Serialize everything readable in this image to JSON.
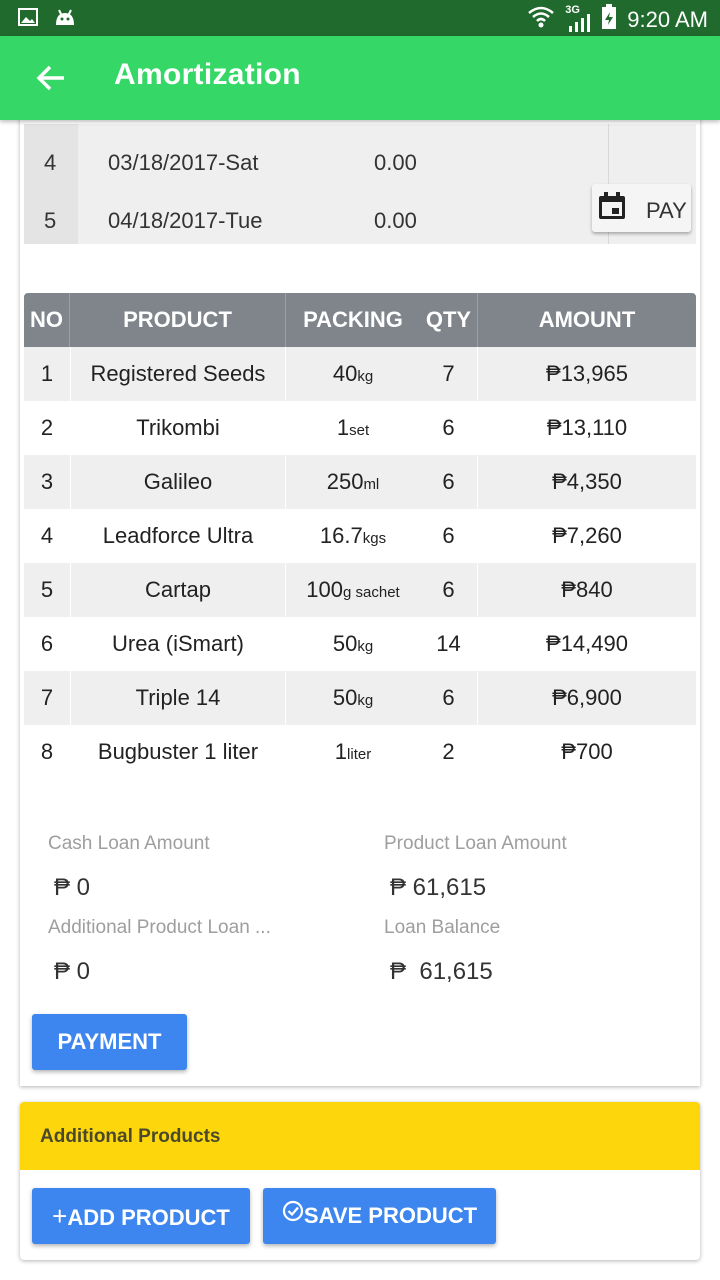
{
  "status_bar": {
    "time": "9:20 AM",
    "network": "3G"
  },
  "app_bar": {
    "title": "Amortization"
  },
  "schedule": {
    "rows": [
      {
        "no": "4",
        "date": "03/18/2017-Sat",
        "amount": "0.00"
      },
      {
        "no": "5",
        "date": "04/18/2017-Tue",
        "amount": "0.00"
      }
    ],
    "pay_label": "PAY"
  },
  "products": {
    "headers": {
      "no": "NO",
      "product": "PRODUCT",
      "packing": "PACKING",
      "qty": "QTY",
      "amount": "AMOUNT"
    },
    "rows": [
      {
        "no": "1",
        "product": "Registered Seeds",
        "pack_qty": "40",
        "pack_unit": "kg",
        "qty": "7",
        "amount": "₱13,965"
      },
      {
        "no": "2",
        "product": "Trikombi",
        "pack_qty": "1",
        "pack_unit": "set",
        "qty": "6",
        "amount": "₱13,110"
      },
      {
        "no": "3",
        "product": "Galileo",
        "pack_qty": "250",
        "pack_unit": "ml",
        "qty": "6",
        "amount": "₱4,350"
      },
      {
        "no": "4",
        "product": "Leadforce Ultra",
        "pack_qty": "16.7",
        "pack_unit": "kgs",
        "qty": "6",
        "amount": "₱7,260"
      },
      {
        "no": "5",
        "product": "Cartap",
        "pack_qty": "100",
        "pack_unit": "g sachet",
        "qty": "6",
        "amount": "₱840"
      },
      {
        "no": "6",
        "product": "Urea (iSmart)",
        "pack_qty": "50",
        "pack_unit": "kg",
        "qty": "14",
        "amount": "₱14,490"
      },
      {
        "no": "7",
        "product": "Triple 14",
        "pack_qty": "50",
        "pack_unit": "kg",
        "qty": "6",
        "amount": "₱6,900"
      },
      {
        "no": "8",
        "product": "Bugbuster 1 liter",
        "pack_qty": "1",
        "pack_unit": "liter",
        "qty": "2",
        "amount": "₱700"
      }
    ]
  },
  "summary": {
    "cash_loan_label": "Cash Loan Amount",
    "cash_loan_value": "₱ 0",
    "product_loan_label": "Product Loan Amount",
    "product_loan_value": "₱ 61,615",
    "additional_label": "Additional Product Loan ...",
    "additional_value": "₱ 0",
    "balance_label": "Loan Balance",
    "balance_value": "₱  61,615"
  },
  "payment_button": "PAYMENT",
  "additional_products": {
    "header": "Additional Products",
    "add_label": "ADD PRODUCT",
    "save_label": "SAVE PRODUCT"
  },
  "colors": {
    "app_bar": "#35d866",
    "status_bar": "#1f6a2c",
    "button_blue": "#3d86f0",
    "table_header": "#7f858b",
    "additional_header": "#fed60c"
  }
}
